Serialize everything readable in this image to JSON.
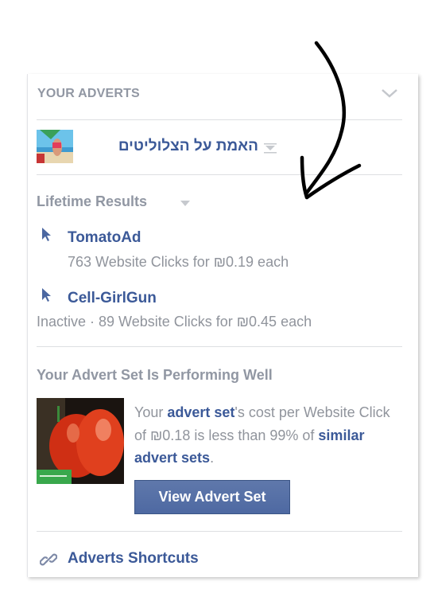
{
  "header": {
    "title": "YOUR ADVERTS",
    "collapse_icon": "chevron-down-icon"
  },
  "account": {
    "name": "האמת על הצלוליטים",
    "dropdown_icon": "caret-down-icon"
  },
  "results": {
    "title": "Lifetime Results",
    "ads": [
      {
        "name": "TomatoAd",
        "meta": "763 Website Clicks for ₪0.19 each",
        "icon": "cursor-icon"
      },
      {
        "name": "Cell-GirlGun",
        "meta": "Inactive · 89 Website Clicks for ₪0.45 each",
        "icon": "cursor-icon"
      }
    ]
  },
  "performance": {
    "title": "Your Advert Set Is Performing Well",
    "text_1": "Your ",
    "link_1": "advert set",
    "text_2": "'s cost per Website Click of ₪0.18 is less than 99% of ",
    "link_2": "similar advert sets",
    "text_3": ".",
    "button": "View Advert Set"
  },
  "shortcuts": {
    "label": "Adverts Shortcuts",
    "icon": "link-icon"
  },
  "colors": {
    "link": "#3b5998",
    "muted": "#9197a3",
    "button": "#4e69a2"
  }
}
